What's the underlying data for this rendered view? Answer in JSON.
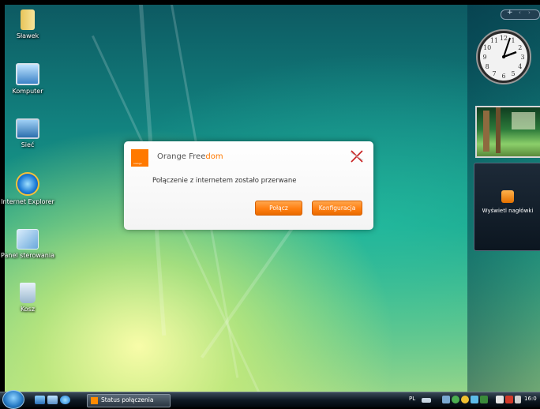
{
  "desktop": {
    "icons": [
      {
        "label": "Sławek"
      },
      {
        "label": "Komputer"
      },
      {
        "label": "Sieć"
      },
      {
        "label": "Internet Explorer"
      },
      {
        "label": "Panel sterowania"
      },
      {
        "label": "Kosz"
      }
    ]
  },
  "sidebar": {
    "clock": {
      "numbers": [
        "12",
        "1",
        "2",
        "3",
        "4",
        "5",
        "6",
        "7",
        "8",
        "9",
        "10",
        "11"
      ]
    },
    "feed_label": "Wyświetl nagłówki"
  },
  "dialog": {
    "title_main": "Orange Free",
    "title_accent": "dom",
    "logo_text": "orange",
    "message": "Połączenie z internetem zostało przerwane",
    "connect_button": "Połącz",
    "config_button": "Konfiguracja"
  },
  "taskbar": {
    "task_label": "Status połączenia",
    "language": "PL",
    "time": "16:0"
  },
  "colors": {
    "brand_orange": "#ff7900"
  }
}
